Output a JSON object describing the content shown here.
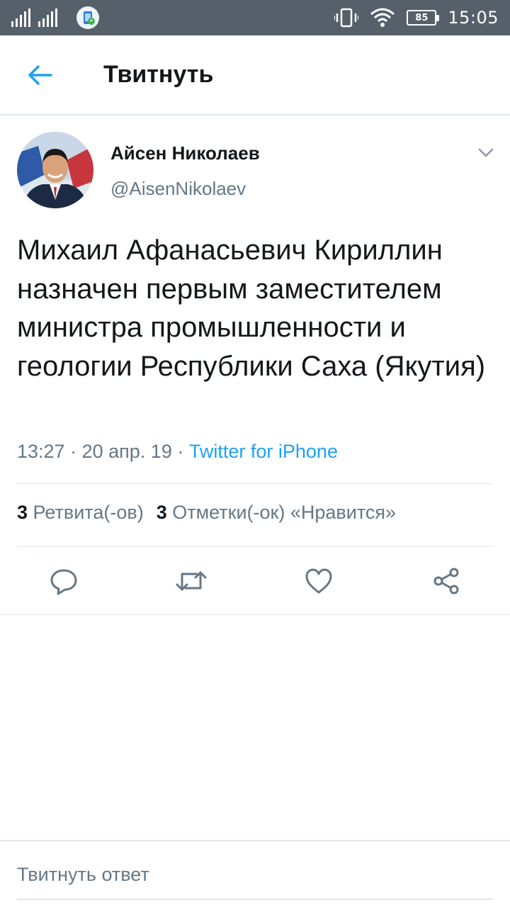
{
  "status_bar": {
    "time": "15:05",
    "battery": "85",
    "icons": [
      "signal-icon",
      "notification-app-icon",
      "vibrate-icon",
      "wifi-icon",
      "battery-icon"
    ]
  },
  "header": {
    "title": "Твитнуть",
    "back_icon": "arrow-left-icon"
  },
  "tweet": {
    "author_name": "Айсен Николаев",
    "author_handle": "@AisenNikolaev",
    "text": "Михаил Афанасьевич Кириллин назначен первым заместителем министра промышленности и геологии Республики Саха (Якутия)",
    "time": "13:27",
    "separator": "·",
    "date": "20 апр. 19",
    "source": "Twitter for iPhone",
    "retweets_count": "3",
    "retweets_label": "Ретвита(-ов)",
    "likes_count": "3",
    "likes_label": "Отметки(-ок) «Нравится»"
  },
  "actions": [
    "reply-icon",
    "retweet-icon",
    "like-icon",
    "share-icon"
  ],
  "reply": {
    "placeholder": "Твитнуть ответ"
  },
  "colors": {
    "accent": "#1da1f2",
    "status_bar": "#55606b",
    "secondary_text": "#657786",
    "divider": "#e1e8ed"
  }
}
